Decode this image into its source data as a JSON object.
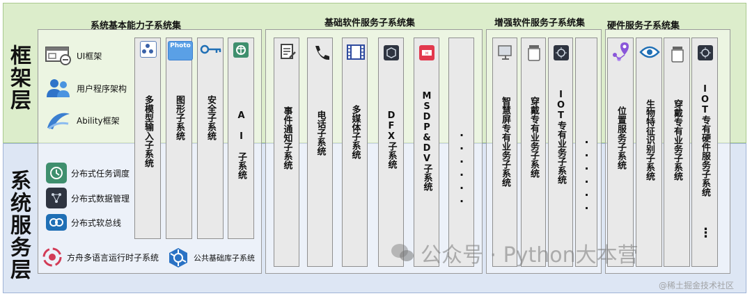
{
  "layers": {
    "framework": "框架层",
    "system_services": "系统服务层"
  },
  "groups": {
    "basic_capability": "系统基本能力子系统集",
    "basic_software": "基础软件服务子系统集",
    "enhanced_software": "增强软件服务子系统集",
    "hardware": "硬件服务子系统集"
  },
  "framework_items": [
    {
      "label": "UI框架",
      "icon": "ui-window-icon"
    },
    {
      "label": "用户程序架构",
      "icon": "users-icon"
    },
    {
      "label": "Ability框架",
      "icon": "ability-swoosh-icon"
    }
  ],
  "distributed_items": [
    {
      "label": "分布式任务调度",
      "icon": "task-schedule-icon"
    },
    {
      "label": "分布式数据管理",
      "icon": "data-management-icon"
    },
    {
      "label": "分布式软总线",
      "icon": "soft-bus-icon"
    }
  ],
  "bottom_items": [
    {
      "label": "方舟多语言运行时子系统",
      "icon": "ark-runtime-icon"
    },
    {
      "label": "公共基础库子系统",
      "icon": "common-library-icon"
    }
  ],
  "basic_capability_columns": [
    {
      "label": "多模型输入子系统",
      "icon": "multimodal-input-icon"
    },
    {
      "label": "图形子系统",
      "icon": "photo-icon",
      "icon_text": "Photo"
    },
    {
      "label": "安全子系统",
      "icon": "key-icon"
    },
    {
      "label": "AI子系统",
      "icon": "ai-brain-icon",
      "display": "A I 子系统"
    }
  ],
  "basic_software_columns": [
    {
      "label": "事件通知子系统",
      "icon": "notes-icon"
    },
    {
      "label": "电话子系统",
      "icon": "phone-icon"
    },
    {
      "label": "多媒体子系统",
      "icon": "film-icon"
    },
    {
      "label": "DFX子系统",
      "icon": "dfx-cube-icon"
    },
    {
      "label": "MSDP&DV子系统",
      "icon": "msdp-app-icon"
    },
    {
      "label": "······",
      "icon": ""
    }
  ],
  "enhanced_software_columns": [
    {
      "label": "智慧屏专有业务子系统",
      "icon": "smart-screen-icon"
    },
    {
      "label": "穿戴专有业务子系统",
      "icon": "wearable-jar-icon"
    },
    {
      "label": "IOT专有业务子系统",
      "icon": "iot-chip-icon"
    },
    {
      "label": "······",
      "icon": ""
    }
  ],
  "hardware_columns": [
    {
      "label": "位置服务子系统",
      "icon": "location-pin-icon"
    },
    {
      "label": "生物特征识别子系统",
      "icon": "eye-icon"
    },
    {
      "label": "穿戴专有业务子系统",
      "icon": "wearable-jar-icon"
    },
    {
      "label": "IOT专有硬件服务子系统",
      "icon": "iot-chip-icon"
    }
  ],
  "hardware_trailing_dots": "⋮",
  "watermarks": {
    "main": "公众号 · Python大本营",
    "corner": "@稀土掘金技术社区"
  },
  "colors": {
    "framework_bg": "#dcedcb",
    "system_bg": "#dde6f4",
    "column_bg": "#e9e9e9"
  }
}
